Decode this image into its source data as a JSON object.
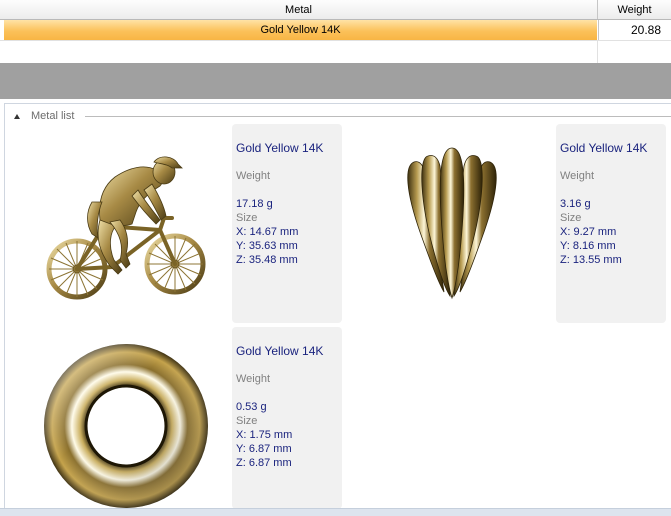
{
  "grid": {
    "headers": {
      "metal": "Metal",
      "weight": "Weight"
    },
    "rows": [
      {
        "metal": "Gold Yellow 14K",
        "weight": "20.88"
      }
    ]
  },
  "metal_list": {
    "title": "Metal list",
    "items": [
      {
        "icon": "cyclist-figure-icon",
        "name": "Gold Yellow 14K",
        "weight_label": "Weight",
        "weight": "17.18 g",
        "size_label": "Size",
        "x": "X: 14.67 mm",
        "y": "Y: 35.63 mm",
        "z": "Z: 35.48 mm"
      },
      {
        "icon": "fluted-pendant-icon",
        "name": "Gold Yellow 14K",
        "weight_label": "Weight",
        "weight": "3.16 g",
        "size_label": "Size",
        "x": "X: 9.27 mm",
        "y": "Y: 8.16 mm",
        "z": "Z: 13.55 mm"
      },
      {
        "icon": "torus-ring-icon",
        "name": "Gold Yellow 14K",
        "weight_label": "Weight",
        "weight": "0.53 g",
        "size_label": "Size",
        "x": "X: 1.75 mm",
        "y": "Y: 6.87 mm",
        "z": "Z: 6.87 mm"
      }
    ]
  },
  "colors": {
    "selection": "#fbc15a",
    "info_text": "#1a237e",
    "label_text": "#808080",
    "gold_dark": "#5a4a1a",
    "gold_light": "#f4e4a8"
  }
}
